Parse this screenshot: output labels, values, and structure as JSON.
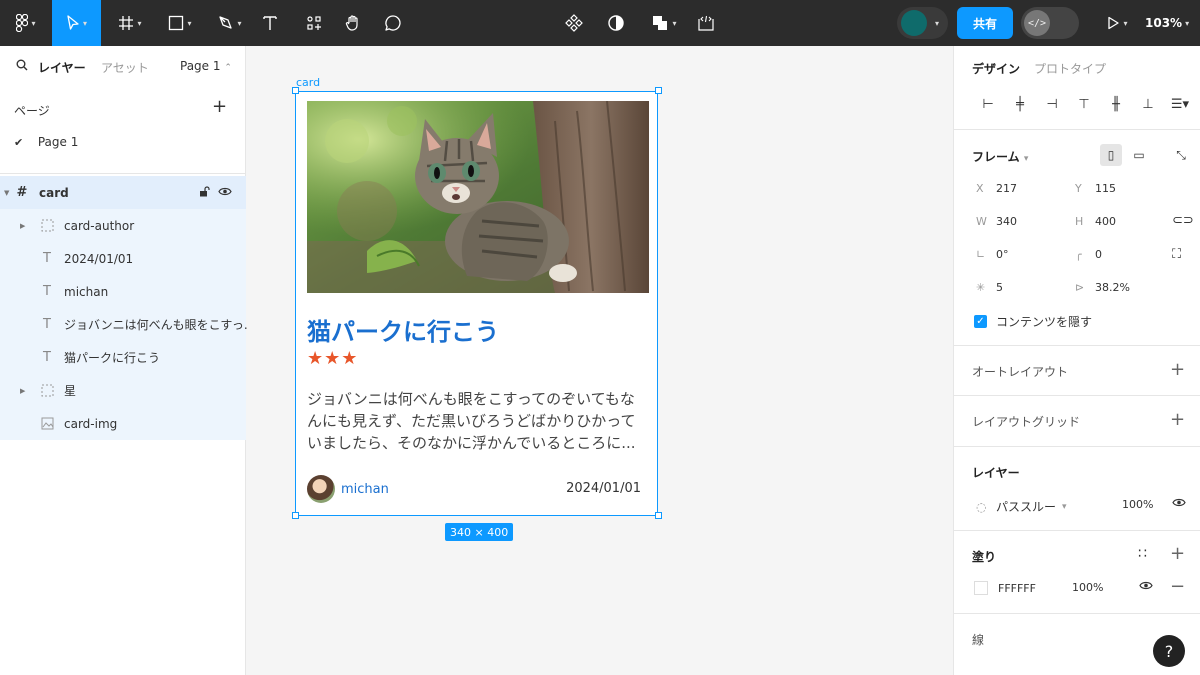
{
  "toolbar": {
    "zoom": "103%",
    "share_label": "共有",
    "dev_mode_label": "</>"
  },
  "left_panel": {
    "tabs": {
      "layers": "レイヤー",
      "assets": "アセット",
      "page_switch": "Page 1"
    },
    "pages_heading": "ページ",
    "pages": [
      {
        "label": "Page 1",
        "selected": true
      }
    ],
    "layers": [
      {
        "label": "card",
        "type": "frame",
        "selected": true
      },
      {
        "label": "card-author",
        "type": "group"
      },
      {
        "label": "2024/01/01",
        "type": "text"
      },
      {
        "label": "michan",
        "type": "text"
      },
      {
        "label": "ジョバンニは何べんも眼をこすっ...",
        "type": "text"
      },
      {
        "label": "猫パークに行こう",
        "type": "text"
      },
      {
        "label": "星",
        "type": "group"
      },
      {
        "label": "card-img",
        "type": "image"
      }
    ]
  },
  "canvas": {
    "frame_label": "card",
    "size_badge": "340 × 400",
    "card": {
      "title": "猫パークに行こう",
      "stars": "★★★",
      "body": "ジョバンニは何べんも眼をこすってのぞいてもなんにも見えず、ただ黒いびろうどばかりひかっていましたら、そのなかに浮かんでいるところに...",
      "author": "michan",
      "date": "2024/01/01"
    }
  },
  "right_panel": {
    "tabs": {
      "design": "デザイン",
      "prototype": "プロトタイプ"
    },
    "frame_heading": "フレーム",
    "props": {
      "x_label": "X",
      "x": "217",
      "y_label": "Y",
      "y": "115",
      "w_label": "W",
      "w": "340",
      "h_label": "H",
      "h": "400",
      "rotation": "0°",
      "radius": "0",
      "spacing": "5",
      "ratio": "38.2%"
    },
    "clip_content_label": "コンテンツを隠す",
    "auto_layout": "オートレイアウト",
    "layout_grid": "レイアウトグリッド",
    "layer_heading": "レイヤー",
    "blend_mode": "パススルー",
    "layer_opacity": "100%",
    "fill_heading": "塗り",
    "fill_color": "FFFFFF",
    "fill_opacity": "100%",
    "stroke_heading": "線",
    "help": "?"
  },
  "colors": {
    "accent": "#0d99ff",
    "title": "#1a6fcf",
    "stars": "#e8562a",
    "toolbar_bg": "#2c2c2c"
  }
}
